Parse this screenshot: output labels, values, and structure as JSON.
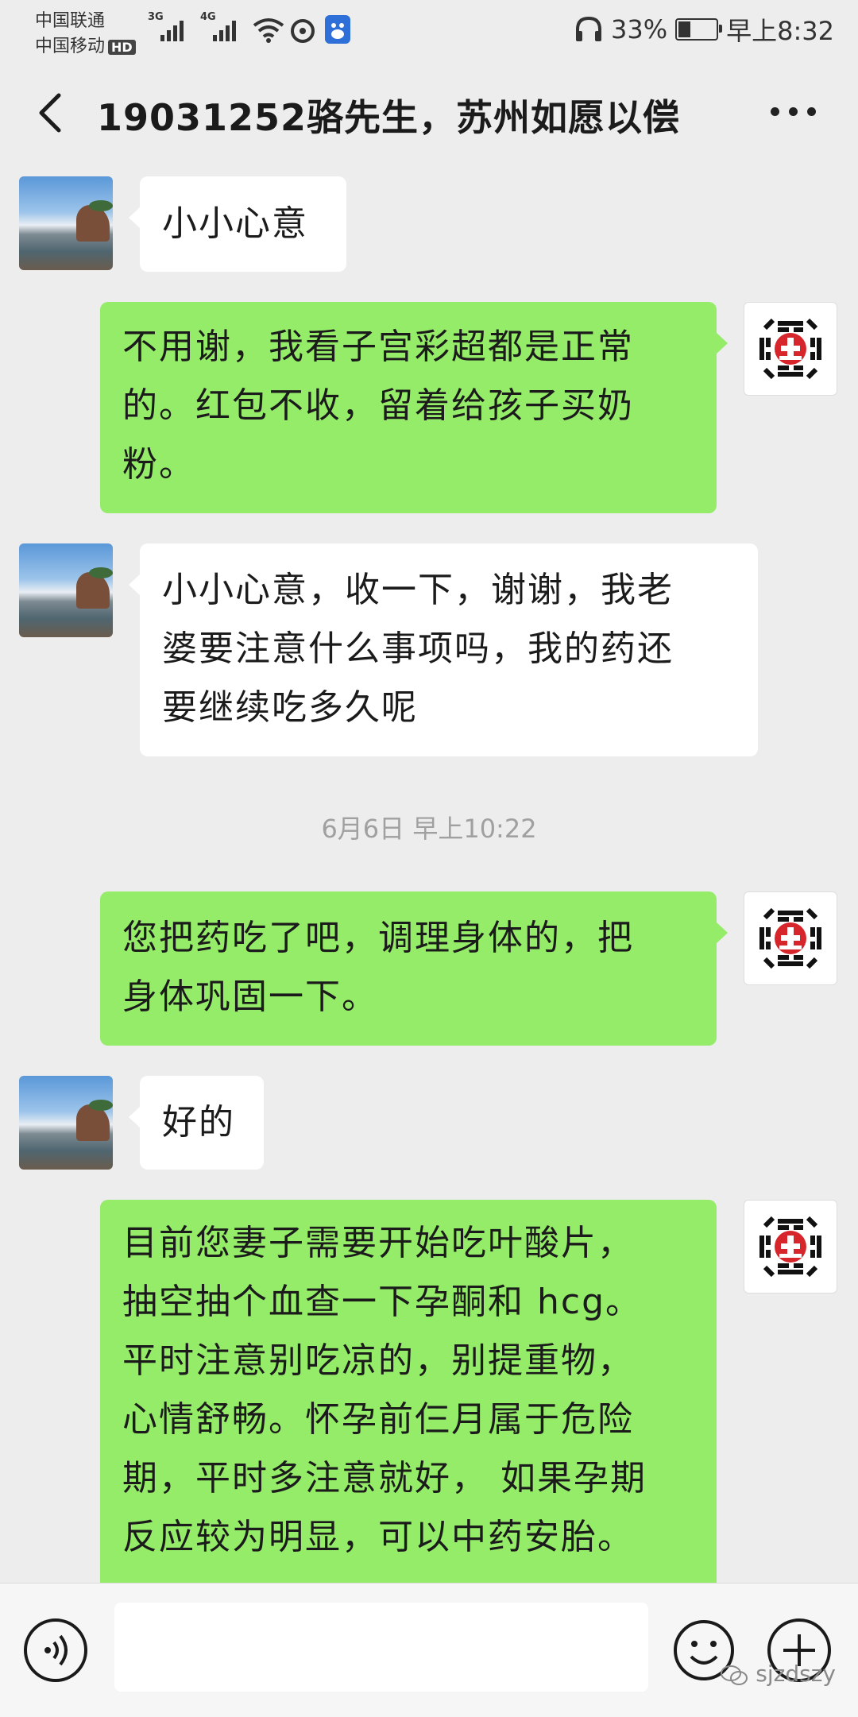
{
  "status_bar": {
    "carrier_1": "中国联通",
    "carrier_2": "中国移动",
    "hd_badge": "HD",
    "network_1": "3G",
    "network_2": "4G",
    "battery": "33%",
    "battery_level": 0.33,
    "time": "早上8:32"
  },
  "header": {
    "title": "19031252骆先生，苏州如愿以偿"
  },
  "messages": [
    {
      "side": "left",
      "text": "小小心意"
    },
    {
      "side": "right",
      "text": "不用谢，我看子宫彩超都是正常\n的。红包不收，留着给孩子买奶\n粉。"
    },
    {
      "side": "left",
      "text": "小小心意，收一下，谢谢，我老\n婆要注意什么事项吗，我的药还\n要继续吃多久呢"
    },
    {
      "side": "right",
      "text": "您把药吃了吧，调理身体的，把\n身体巩固一下。"
    },
    {
      "side": "left",
      "text": "好的"
    },
    {
      "side": "right",
      "text": "目前您妻子需要开始吃叶酸片，\n抽空抽个血查一下孕酮和 hcg。\n平时注意别吃凉的，别提重物，\n心情舒畅。怀孕前仨月属于危险\n期，平时多注意就好， 如果孕期\n反应较为明显，可以中药安胎。"
    }
  ],
  "timestamp": "6月6日 早上10:22",
  "input": {
    "value": ""
  },
  "watermark": "sjzdszy",
  "icons": {
    "back": "chevron-left-icon",
    "more": "more-dots-icon",
    "voice": "voice-icon",
    "emoji": "emoji-icon",
    "plus": "plus-icon"
  },
  "colors": {
    "background": "#ededed",
    "sent_bubble": "#95ec69",
    "received_bubble": "#ffffff",
    "logo_red": "#d7262b"
  }
}
